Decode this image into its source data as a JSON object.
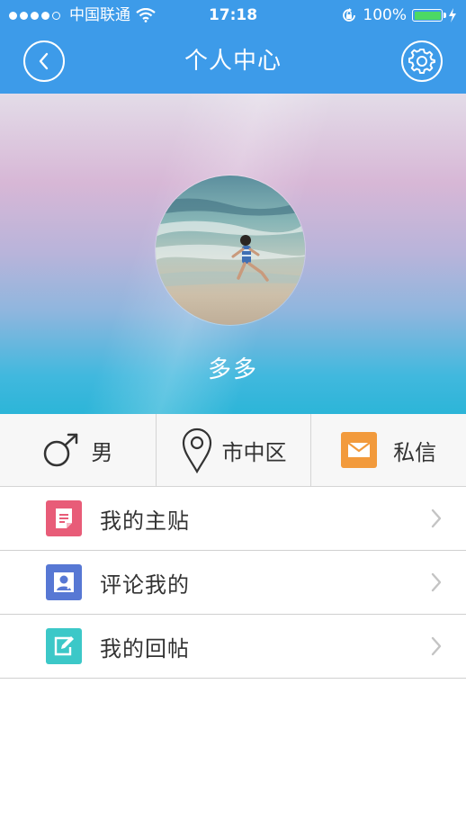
{
  "status_bar": {
    "carrier": "中国联通",
    "time": "17:18",
    "battery_percent": "100%",
    "signal_bars_filled": 4,
    "signal_bars_total": 5
  },
  "nav": {
    "title": "个人中心",
    "back_icon": "back-chevron-icon",
    "settings_icon": "gear-icon"
  },
  "profile": {
    "username": "多多",
    "avatar_alt": "beach photo avatar"
  },
  "info": {
    "gender": "男",
    "location": "市中区",
    "messages": "私信"
  },
  "menu": {
    "items": [
      {
        "label": "我的主贴",
        "icon": "document-icon",
        "color": "#e85c78"
      },
      {
        "label": "评论我的",
        "icon": "user-comment-icon",
        "color": "#5778d4"
      },
      {
        "label": "我的回帖",
        "icon": "edit-icon",
        "color": "#3cc8c8"
      }
    ]
  },
  "colors": {
    "nav_bg": "#3d9be9",
    "message_icon_bg": "#f29a3c"
  }
}
